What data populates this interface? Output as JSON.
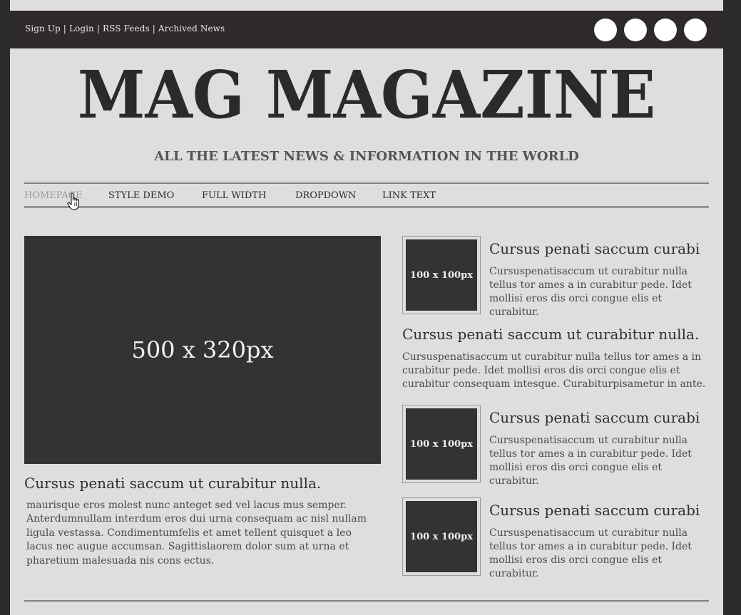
{
  "topbar": {
    "links": [
      "Sign Up",
      "Login",
      "RSS Feeds",
      "Archived News"
    ],
    "separator": "|"
  },
  "header": {
    "title": "MAG MAGAZINE",
    "tagline": "ALL THE LATEST NEWS & INFORMATION IN THE WORLD"
  },
  "nav": {
    "items": [
      "HOMEPAGE",
      "STYLE DEMO",
      "FULL WIDTH",
      "DROPDOWN",
      "LINK TEXT"
    ],
    "active_index": 0
  },
  "feature": {
    "image_label": "500 x 320px",
    "title": "Cursus penati saccum ut curabitur nulla.",
    "body": "maurisque eros molest nunc anteget sed vel lacus mus semper. Anterdumnullam interdum eros dui urna consequam ac nisl nullam ligula vestassa. Condimentumfelis et amet tellent quisquet a leo lacus nec augue accumsan. Sagittislaorem dolor sum at urna et pharetium malesuada nis cons ectus."
  },
  "side": {
    "items": [
      {
        "image_label": "100 x 100px",
        "title": "Cursus penati saccum curabi",
        "body": "Cursuspenatisaccum ut curabitur nulla tellus tor ames a in curabitur pede. Idet mollisi eros dis orci congue elis et curabitur."
      },
      {
        "image_label": "100 x 100px",
        "title": "Cursus penati saccum curabi",
        "body": "Cursuspenatisaccum ut curabitur nulla tellus tor ames a in curabitur pede. Idet mollisi eros dis orci congue elis et curabitur."
      },
      {
        "image_label": "100 x 100px",
        "title": "Cursus penati saccum curabi",
        "body": "Cursuspenatisaccum ut curabitur nulla tellus tor ames a in curabitur pede. Idet mollisi eros dis orci congue elis et curabitur."
      }
    ],
    "middle": {
      "title": "Cursus penati saccum ut curabitur nulla.",
      "body": "Cursuspenatisaccum ut curabitur nulla tellus tor ames a in curabitur pede. Idet mollisi eros dis orci congue elis et curabitur consequam intesque. Curabiturpisametur in ante."
    }
  },
  "colors": {
    "background": "#2b2b2b",
    "page": "#dedede",
    "topbar": "#2f2a2a",
    "placeholder": "#333333"
  },
  "icons": [
    "social-icon-1",
    "social-icon-2",
    "social-icon-3",
    "social-icon-4",
    "hand-cursor-icon"
  ]
}
